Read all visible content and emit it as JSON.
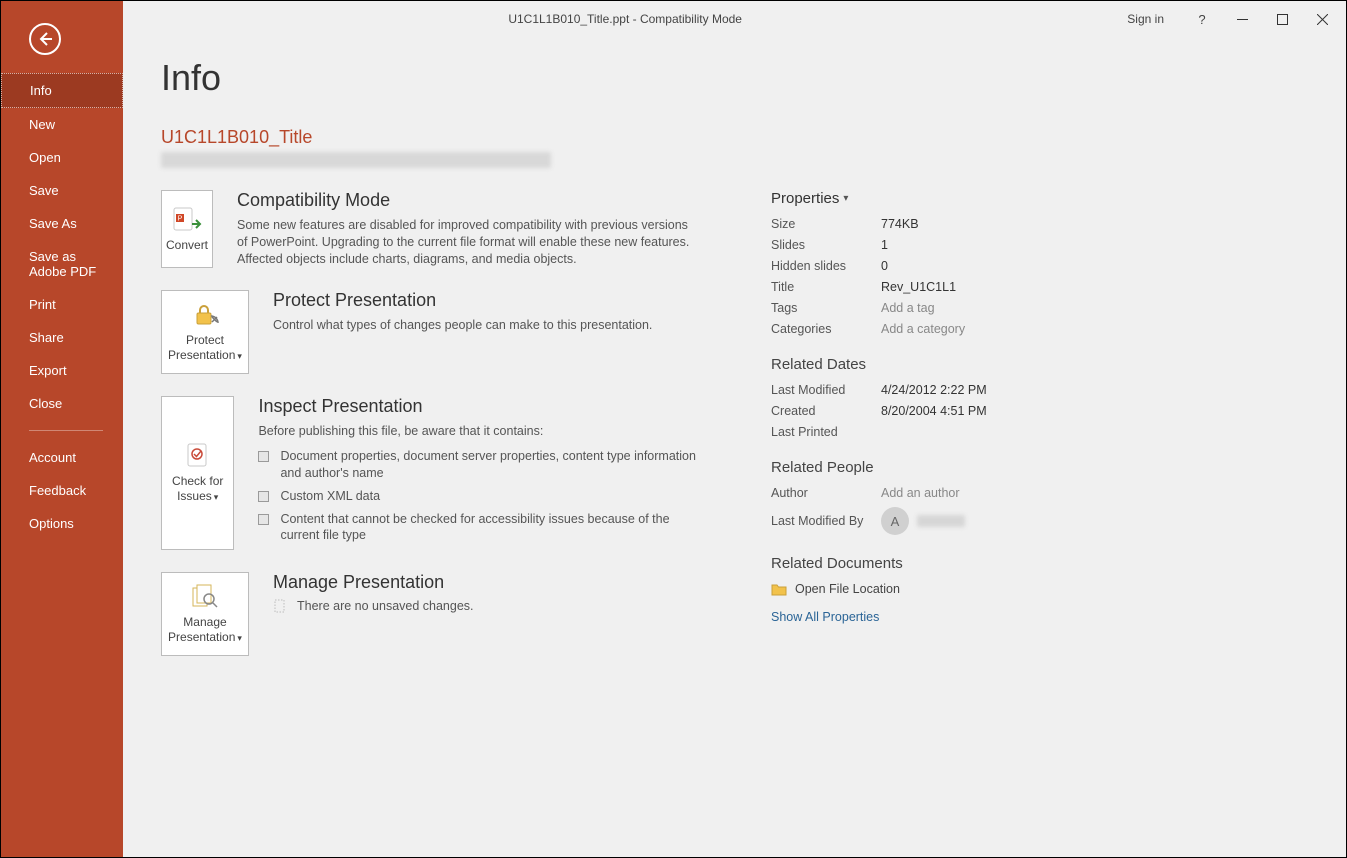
{
  "window": {
    "title": "U1C1L1B010_Title.ppt  -  Compatibility Mode",
    "signin": "Sign in",
    "help": "?"
  },
  "sidebar": {
    "items": [
      {
        "label": "Info",
        "active": true
      },
      {
        "label": "New"
      },
      {
        "label": "Open"
      },
      {
        "label": "Save"
      },
      {
        "label": "Save As"
      },
      {
        "label": "Save as Adobe PDF"
      },
      {
        "label": "Print"
      },
      {
        "label": "Share"
      },
      {
        "label": "Export"
      },
      {
        "label": "Close"
      }
    ],
    "footer": [
      {
        "label": "Account"
      },
      {
        "label": "Feedback"
      },
      {
        "label": "Options"
      }
    ]
  },
  "main": {
    "page_title": "Info",
    "file_title": "U1C1L1B010_Title",
    "sections": {
      "compat": {
        "btn": "Convert",
        "head": "Compatibility Mode",
        "desc": "Some new features are disabled for improved compatibility with previous versions of PowerPoint. Upgrading to the current file format will enable these new features. Affected objects include charts, diagrams, and media objects."
      },
      "protect": {
        "btn_line1": "Protect",
        "btn_line2": "Presentation",
        "head": "Protect Presentation",
        "desc": "Control what types of changes people can make to this presentation."
      },
      "inspect": {
        "btn_line1": "Check for",
        "btn_line2": "Issues",
        "head": "Inspect Presentation",
        "desc": "Before publishing this file, be aware that it contains:",
        "items": [
          "Document properties, document server properties, content type information and author's name",
          "Custom XML data",
          "Content that cannot be checked for accessibility issues because of the current file type"
        ]
      },
      "manage": {
        "btn_line1": "Manage",
        "btn_line2": "Presentation",
        "head": "Manage Presentation",
        "line": "There are no unsaved changes."
      }
    }
  },
  "properties": {
    "heading": "Properties",
    "rows": {
      "size_k": "Size",
      "size_v": "774KB",
      "slides_k": "Slides",
      "slides_v": "1",
      "hidden_k": "Hidden slides",
      "hidden_v": "0",
      "title_k": "Title",
      "title_v": "Rev_U1C1L1",
      "tags_k": "Tags",
      "tags_v": "Add a tag",
      "cat_k": "Categories",
      "cat_v": "Add a category"
    },
    "dates_head": "Related Dates",
    "dates": {
      "lm_k": "Last Modified",
      "lm_v": "4/24/2012 2:22 PM",
      "cr_k": "Created",
      "cr_v": "8/20/2004 4:51 PM",
      "lp_k": "Last Printed",
      "lp_v": ""
    },
    "people_head": "Related People",
    "people": {
      "author_k": "Author",
      "author_v": "Add an author",
      "lmb_k": "Last Modified By",
      "avatar_initial": "A"
    },
    "docs_head": "Related Documents",
    "open_loc": "Open File Location",
    "show_all": "Show All Properties"
  }
}
